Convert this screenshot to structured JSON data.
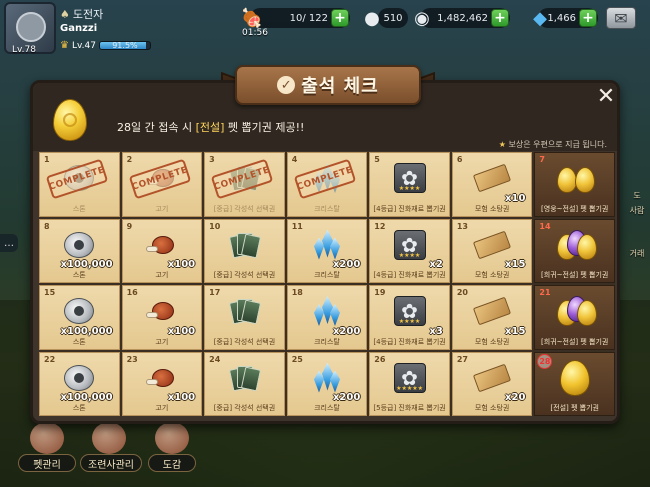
{
  "hud": {
    "rank_name": "도전자",
    "nickname": "Ganzzi",
    "avatar_level": "Lv.78",
    "level": "Lv.47",
    "xp_percent_text": "91.5%",
    "xp_percent": 91.5,
    "meat_count": "10/ 122",
    "meat_timer": "01:56",
    "stone_count": "510",
    "coin_count": "1,482,462",
    "crystal_count": "1,466"
  },
  "side": {
    "right_labels": [
      "도",
      "사람",
      "거래"
    ]
  },
  "bottom_nav": [
    "펫관리",
    "조련사관리",
    "도감"
  ],
  "modal": {
    "title": "출석 체크",
    "banner_prefix": "28일 간 접속 시 ",
    "banner_highlight": "[전설]",
    "banner_suffix": " 펫 뽑기권 제공!!",
    "note": "보상은 우편으로 지급 됩니다.",
    "stamp_text": "COMPLETE",
    "days": [
      {
        "day": "1",
        "icon": "stone",
        "qty": "",
        "label": "스톤",
        "claimed": true
      },
      {
        "day": "2",
        "icon": "meat",
        "qty": "",
        "label": "고기",
        "claimed": true
      },
      {
        "day": "3",
        "icon": "cards",
        "qty": "",
        "label": "[중급] 각성석 선택권",
        "claimed": true
      },
      {
        "day": "4",
        "icon": "crystal",
        "qty": "",
        "label": "크리스탈",
        "claimed": true
      },
      {
        "day": "5",
        "icon": "evo",
        "qty": "",
        "label": "[4등급] 진화재료 뽑기권",
        "claimed": false
      },
      {
        "day": "6",
        "icon": "ticket",
        "qty": "x10",
        "label": "모험 소탕권",
        "claimed": false
      },
      {
        "day": "7",
        "icon": "eggs",
        "qty": "",
        "label": "[영웅~전설] 펫 뽑기권",
        "claimed": false,
        "highlight": true
      },
      {
        "day": "8",
        "icon": "stone",
        "qty": "x100,000",
        "label": "스톤",
        "claimed": false
      },
      {
        "day": "9",
        "icon": "meat",
        "qty": "x100",
        "label": "고기",
        "claimed": false
      },
      {
        "day": "10",
        "icon": "cards",
        "qty": "",
        "label": "[중급] 각성석 선택권",
        "claimed": false
      },
      {
        "day": "11",
        "icon": "crystal",
        "qty": "x200",
        "label": "크리스탈",
        "claimed": false
      },
      {
        "day": "12",
        "icon": "evo",
        "qty": "x2",
        "label": "[4등급] 진화재료 뽑기권",
        "claimed": false
      },
      {
        "day": "13",
        "icon": "ticket",
        "qty": "x15",
        "label": "모험 소탕권",
        "claimed": false
      },
      {
        "day": "14",
        "icon": "eggs_mixed",
        "qty": "",
        "label": "[희귀~전설] 펫 뽑기권",
        "claimed": false,
        "highlight": true
      },
      {
        "day": "15",
        "icon": "stone",
        "qty": "x100,000",
        "label": "스톤",
        "claimed": false
      },
      {
        "day": "16",
        "icon": "meat",
        "qty": "x100",
        "label": "고기",
        "claimed": false
      },
      {
        "day": "17",
        "icon": "cards",
        "qty": "",
        "label": "[중급] 각성석 선택권",
        "claimed": false
      },
      {
        "day": "18",
        "icon": "crystal",
        "qty": "x200",
        "label": "크리스탈",
        "claimed": false
      },
      {
        "day": "19",
        "icon": "evo",
        "qty": "x3",
        "label": "[4등급] 진화재료 뽑기권",
        "claimed": false
      },
      {
        "day": "20",
        "icon": "ticket",
        "qty": "x15",
        "label": "모험 소탕권",
        "claimed": false
      },
      {
        "day": "21",
        "icon": "eggs_mixed",
        "qty": "",
        "label": "[희귀~전설] 펫 뽑기권",
        "claimed": false,
        "highlight": true
      },
      {
        "day": "22",
        "icon": "stone",
        "qty": "x100,000",
        "label": "스톤",
        "claimed": false
      },
      {
        "day": "23",
        "icon": "meat",
        "qty": "x100",
        "label": "고기",
        "claimed": false
      },
      {
        "day": "24",
        "icon": "cards",
        "qty": "",
        "label": "[중급] 각성석 선택권",
        "claimed": false
      },
      {
        "day": "25",
        "icon": "crystal",
        "qty": "x200",
        "label": "크리스탈",
        "claimed": false
      },
      {
        "day": "26",
        "icon": "evo5",
        "qty": "",
        "label": "[5등급] 진화재료 뽑기권",
        "claimed": false
      },
      {
        "day": "27",
        "icon": "ticket",
        "qty": "x20",
        "label": "모험 소탕권",
        "claimed": false
      },
      {
        "day": "28",
        "icon": "bigegg",
        "qty": "",
        "label": "[전설] 펫 뽑기권",
        "claimed": false,
        "highlight": true,
        "circled": true
      }
    ]
  }
}
